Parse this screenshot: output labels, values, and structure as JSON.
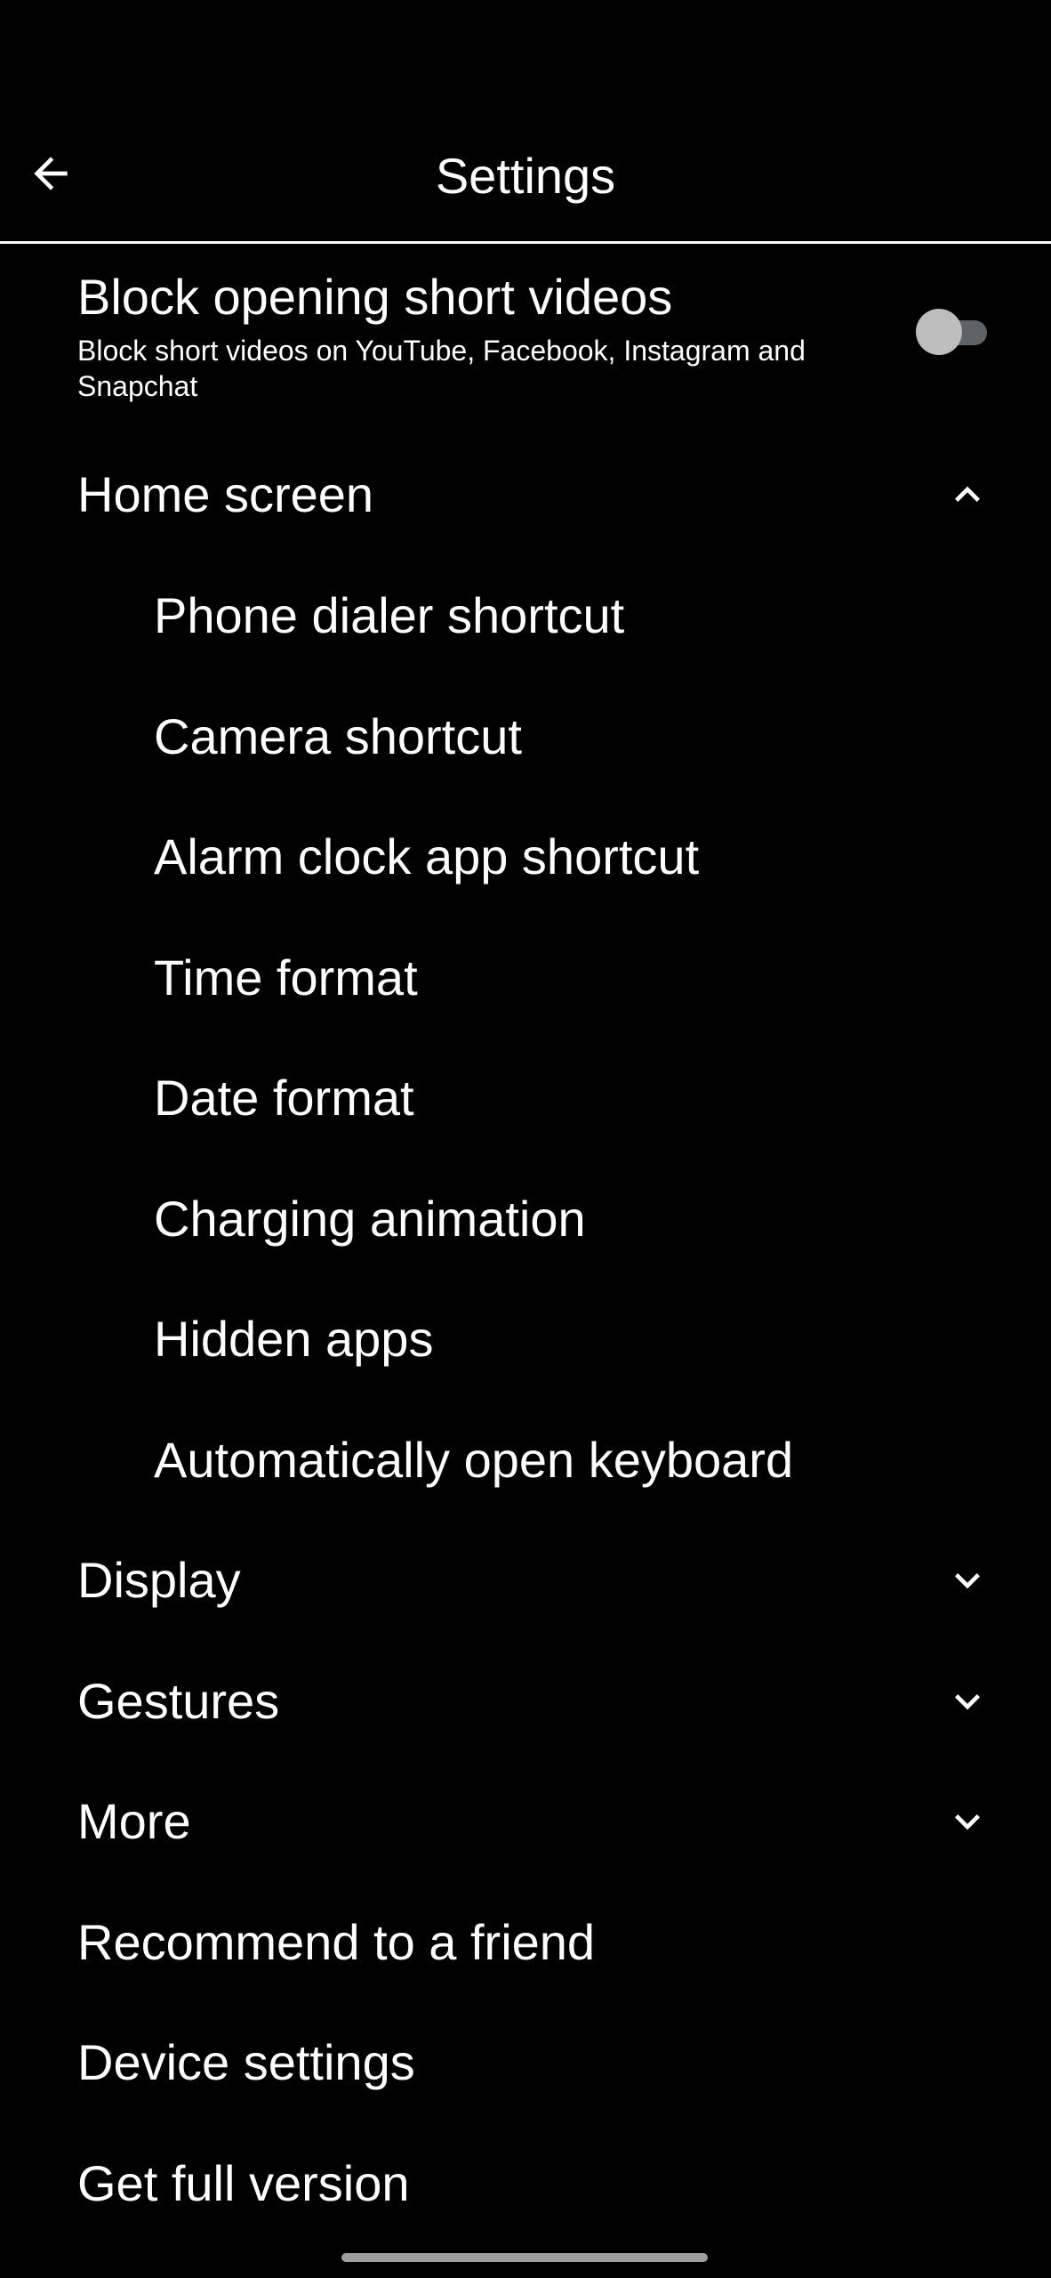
{
  "header": {
    "title": "Settings",
    "back_icon": "arrow-left-icon"
  },
  "toggle_setting": {
    "title": "Block opening short videos",
    "description": "Block short videos on YouTube, Facebook, Instagram and Snapchat",
    "enabled": false
  },
  "sections": {
    "home_screen": {
      "label": "Home screen",
      "expanded": true,
      "items": [
        {
          "label": "Phone dialer shortcut"
        },
        {
          "label": "Camera shortcut"
        },
        {
          "label": "Alarm clock app shortcut"
        },
        {
          "label": "Time format"
        },
        {
          "label": "Date format"
        },
        {
          "label": "Charging animation"
        },
        {
          "label": "Hidden apps"
        },
        {
          "label": "Automatically open keyboard"
        }
      ]
    },
    "display": {
      "label": "Display",
      "expanded": false
    },
    "gestures": {
      "label": "Gestures",
      "expanded": false
    },
    "more": {
      "label": "More",
      "expanded": false
    }
  },
  "actions": {
    "recommend": "Recommend to a friend",
    "device_settings": "Device settings",
    "full_version": "Get full version"
  },
  "colors": {
    "background": "#000000",
    "text": "#ffffff",
    "toggle_off_track": "#5f6368",
    "toggle_off_thumb": "#bdbdbd"
  }
}
